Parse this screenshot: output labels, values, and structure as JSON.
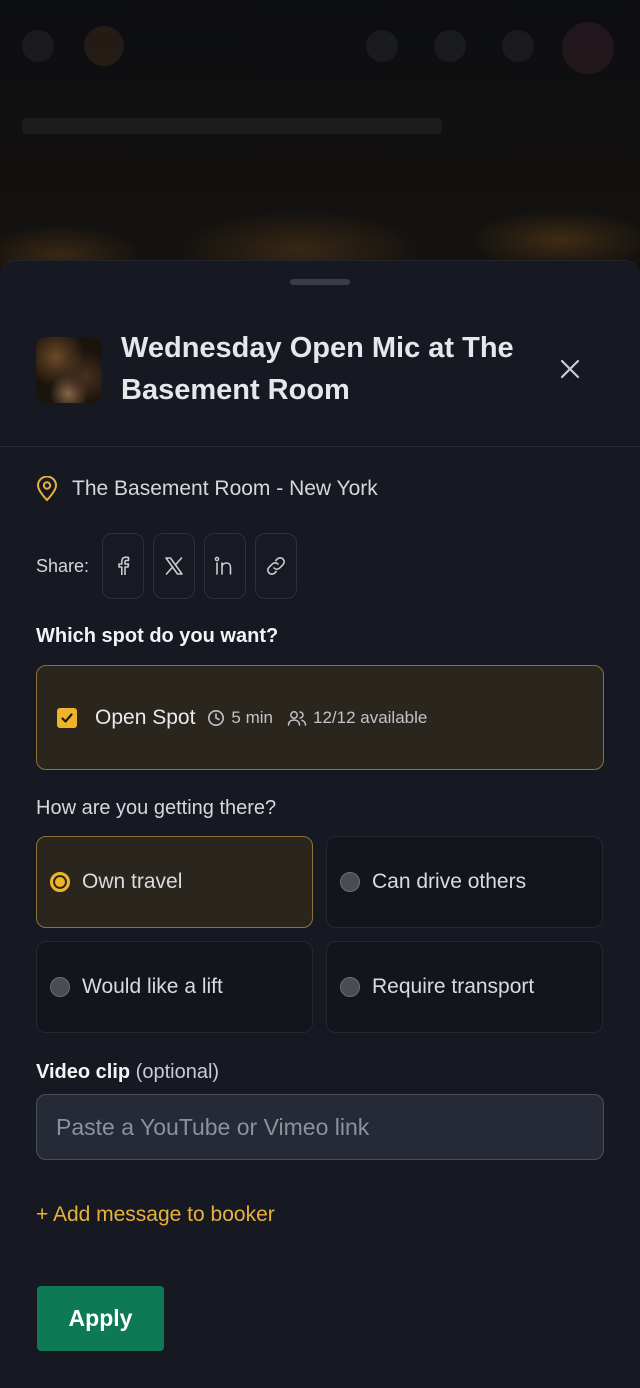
{
  "event": {
    "title": "Wednesday Open Mic at The Basement Room",
    "location": "The Basement Room - New York"
  },
  "share": {
    "label": "Share:",
    "buttons": [
      "facebook-icon",
      "x-icon",
      "linkedin-icon",
      "link-icon"
    ]
  },
  "spot_question": "Which spot do you want?",
  "spot": {
    "name": "Open Spot",
    "duration": "5 min",
    "availability": "12/12 available",
    "checked": true
  },
  "travel_question": "How are you getting there?",
  "travel_options": [
    {
      "label": "Own travel",
      "selected": true
    },
    {
      "label": "Can drive others",
      "selected": false
    },
    {
      "label": "Would like a lift",
      "selected": false
    },
    {
      "label": "Require transport",
      "selected": false
    }
  ],
  "video": {
    "label": "Video clip",
    "optional": "(optional)",
    "placeholder": "Paste a YouTube or Vimeo link"
  },
  "add_message": "+ Add message to booker",
  "apply_label": "Apply",
  "colors": {
    "accent": "#f0b429",
    "primary_button": "#0e7a55",
    "sheet_bg": "#161922"
  }
}
